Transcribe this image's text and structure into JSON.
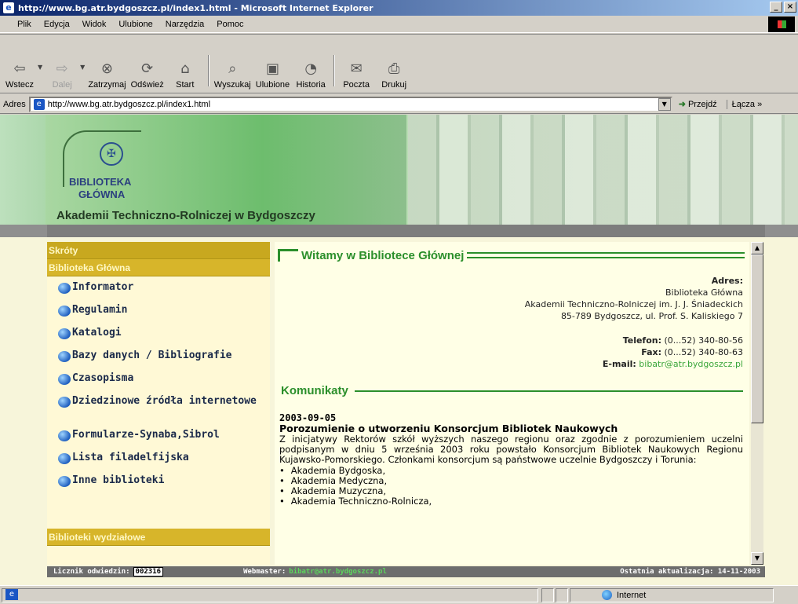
{
  "window": {
    "title": "http://www.bg.atr.bydgoszcz.pl/index1.html - Microsoft Internet Explorer",
    "controls": [
      "_",
      "×"
    ]
  },
  "menu": [
    "Plik",
    "Edycja",
    "Widok",
    "Ulubione",
    "Narzędzia",
    "Pomoc"
  ],
  "toolbar": {
    "back": "Wstecz",
    "forward": "Dalej",
    "stop": "Zatrzymaj",
    "refresh": "Odśwież",
    "home": "Start",
    "search": "Wyszukaj",
    "favorites": "Ulubione",
    "history": "Historia",
    "mail": "Poczta",
    "print": "Drukuj"
  },
  "address": {
    "label": "Adres",
    "value": "http://www.bg.atr.bydgoszcz.pl/index1.html",
    "go": "Przejdź",
    "links": "Łącza »"
  },
  "banner": {
    "line1": "BIBLIOTEKA",
    "line2": "GŁÓWNA",
    "line3": "Akademii Techniczno-Rolniczej w Bydgoszczy"
  },
  "sidebar": {
    "header1": "Skróty",
    "header2": "Biblioteka Główna",
    "items": [
      "Informator",
      "Regulamin",
      "Katalogi",
      "Bazy danych / Bibliografie",
      "Czasopisma",
      "Dziedzinowe źródła internetowe",
      "Formularze-Synaba,Sibrol",
      "Lista filadelfijska",
      "Inne biblioteki"
    ],
    "header3": "Biblioteki wydziałowe"
  },
  "main": {
    "welcome": "Witamy w Bibliotece Głównej",
    "address_label": "Adres:",
    "address_lines": [
      "Biblioteka Główna",
      "Akademii Techniczno-Rolniczej im. J. J. Śniadeckich",
      "85-789 Bydgoszcz, ul. Prof. S. Kaliskiego 7"
    ],
    "phone_label": "Telefon:",
    "phone": "(0...52) 340-80-56",
    "fax_label": "Fax:",
    "fax": "(0...52) 340-80-63",
    "email_label": "E-mail:",
    "email": "bibatr@atr.bydgoszcz.pl",
    "news_title": "Komunikaty",
    "news_date": "2003-09-05",
    "news_headline": "Porozumienie o utworzeniu Konsorcjum Bibliotek Naukowych",
    "news_body": "Z inicjatywy Rektorów szkół wyższych naszego regionu oraz zgodnie z porozumieniem uczelni podpisanym w dniu 5 września 2003 roku powstało Konsorcjum Bibliotek Naukowych Regionu Kujawsko-Pomorskiego. Członkami konsorcjum są państwowe uczelnie Bydgoszczy i Torunia:",
    "news_list": [
      "Akademia Bydgoska,",
      "Akademia Medyczna,",
      "Akademia Muzyczna,",
      "Akademia Techniczno-Rolnicza,"
    ]
  },
  "footer": {
    "counter_label": "Licznik odwiedzin:",
    "counter_value": "002316",
    "webmaster_label": "Webmaster:",
    "webmaster": "bibatr@atr.bydgoszcz.pl",
    "updated": "Ostatnia aktualizacja: 14-11-2003"
  },
  "statusbar": {
    "zone": "Internet"
  }
}
